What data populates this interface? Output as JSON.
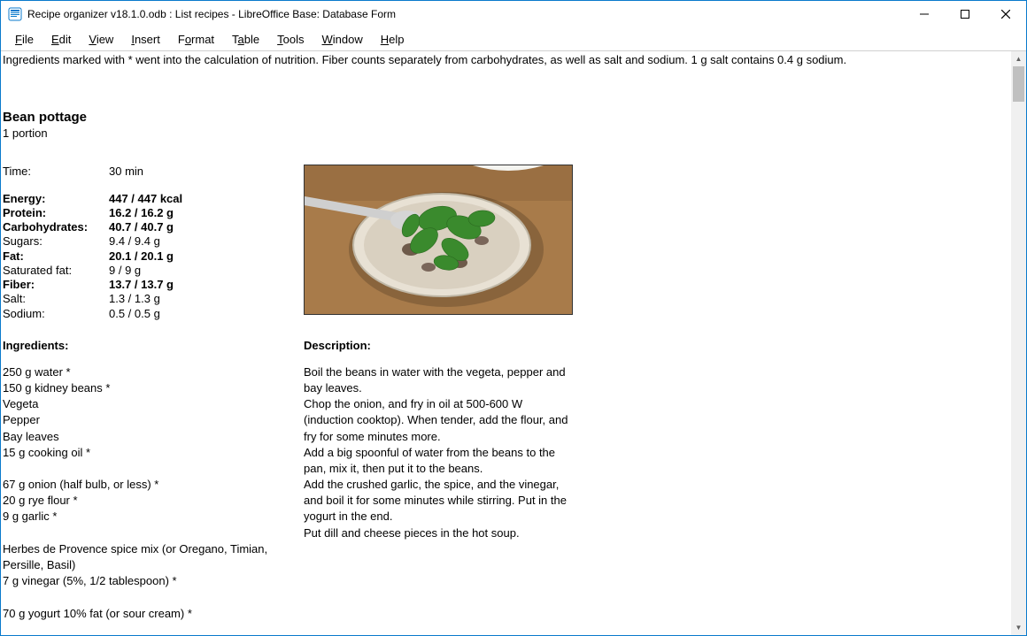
{
  "window": {
    "title": "Recipe organizer v18.1.0.odb : List recipes - LibreOffice Base: Database Form"
  },
  "menu": [
    "File",
    "Edit",
    "View",
    "Insert",
    "Format",
    "Table",
    "Tools",
    "Window",
    "Help"
  ],
  "note": "Ingredients marked with * went into the calculation of nutrition. Fiber counts separately from carbohydrates, as well as salt and sodium. 1 g salt contains 0.4 g sodium.",
  "recipe": {
    "title": "Bean pottage",
    "portion": "1 portion",
    "time_label": "Time:",
    "time_value": "30 min",
    "nutrition": [
      {
        "label": "Energy:",
        "value": "447 / 447 kcal",
        "bold": true
      },
      {
        "label": "Protein:",
        "value": "16.2 / 16.2 g",
        "bold": true
      },
      {
        "label": "Carbohydrates:",
        "value": "40.7 / 40.7 g",
        "bold": true
      },
      {
        "label": "Sugars:",
        "value": "9.4 / 9.4 g",
        "bold": false
      },
      {
        "label": "Fat:",
        "value": "20.1 / 20.1 g",
        "bold": true
      },
      {
        "label": "Saturated fat:",
        "value": "9 / 9 g",
        "bold": false
      },
      {
        "label": "Fiber:",
        "value": "13.7 / 13.7 g",
        "bold": true
      },
      {
        "label": "Salt:",
        "value": "1.3 / 1.3 g",
        "bold": false
      },
      {
        "label": "Sodium:",
        "value": "0.5 / 0.5 g",
        "bold": false
      }
    ],
    "ingredients_heading": "Ingredients:",
    "ingredients": "250 g water *\n150 g kidney beans *\nVegeta\nPepper\nBay leaves\n15 g cooking oil *\n\n67 g onion (half bulb, or less) *\n20 g rye flour *\n9 g garlic *\n\nHerbes de Provence spice mix (or Oregano, Timian, Persille, Basil)\n7 g vinegar (5%, 1/2 tablespoon) *\n\n70 g yogurt 10% fat (or sour cream) *",
    "description_heading": "Description:",
    "description": "Boil the beans in water with the vegeta, pepper and bay leaves.\nChop the onion, and fry in oil at 500-600 W (induction cooktop). When tender, add the flour, and fry for some minutes more.\nAdd a big spoonful of water from the beans to the pan, mix it, then put it to the beans.\nAdd the crushed garlic, the spice, and the vinegar, and boil it for some minutes while stirring. Put in the yogurt in the end.\nPut dill and cheese pieces in the hot soup."
  }
}
